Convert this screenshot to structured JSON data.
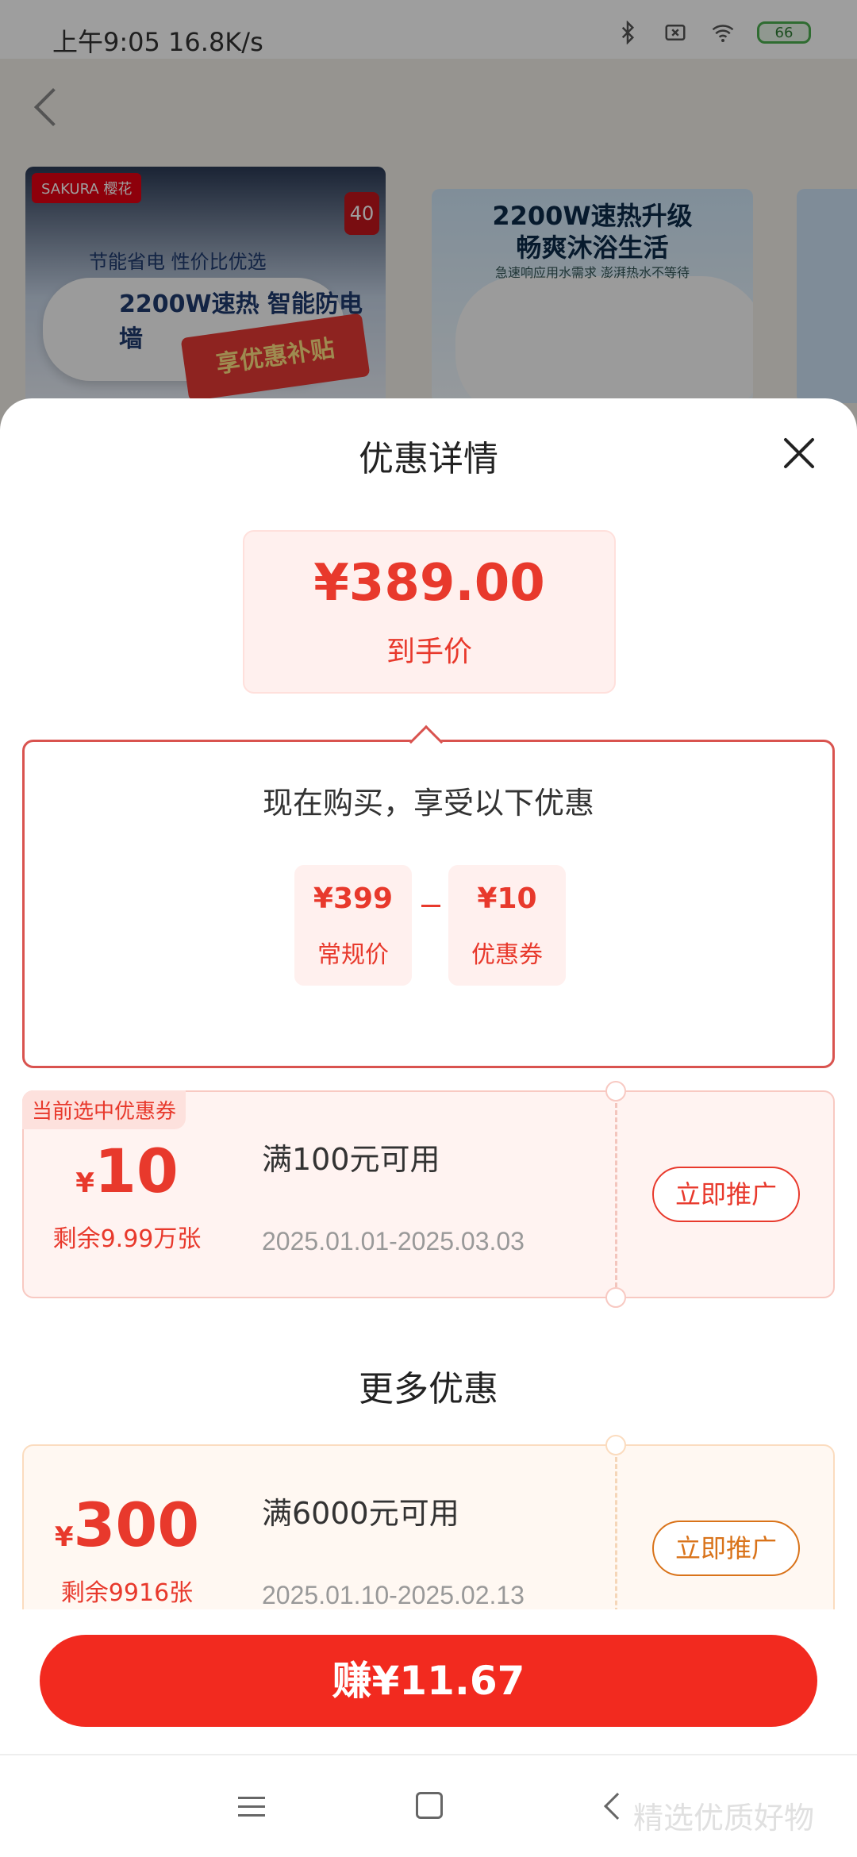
{
  "status": {
    "time": "上午9:05",
    "speed": "16.8K/s",
    "battery": "66"
  },
  "background": {
    "thumb1": {
      "brand": "SAKURA 樱花",
      "badge": "40",
      "line1": "节能省电 性价比优选",
      "line2": "2200W速热 智能防电墙",
      "promo": "享优惠补贴"
    },
    "thumb2": {
      "title_line1": "2200W速热升级",
      "title_line2": "畅爽沐浴生活",
      "sub": "急速响应用水需求 澎湃热水不等待"
    }
  },
  "sheet": {
    "title": "优惠详情",
    "price": {
      "amount": "¥389.00",
      "label": "到手价"
    },
    "detail": {
      "heading": "现在购买，享受以下优惠",
      "regular": {
        "value": "¥399",
        "label": "常规价"
      },
      "coupon": {
        "value": "¥10",
        "label": "优惠券"
      }
    },
    "selected_coupon": {
      "tag": "当前选中优惠券",
      "yen": "¥",
      "amount": "10",
      "remain": "剩余9.99万张",
      "condition": "满100元可用",
      "dates": "2025.01.01-2025.03.03",
      "button": "立即推广"
    },
    "more_title": "更多优惠",
    "more_coupon": {
      "yen": "¥",
      "amount": "300",
      "remain": "剩余9916张",
      "condition": "满6000元可用",
      "dates": "2025.01.10-2025.02.13",
      "button": "立即推广"
    },
    "earn_button": "赚¥11.67"
  },
  "watermark": "精选优质好物",
  "colors": {
    "accent": "#e8392c",
    "earn_button": "#f22a1f",
    "orange": "#d9731a"
  }
}
